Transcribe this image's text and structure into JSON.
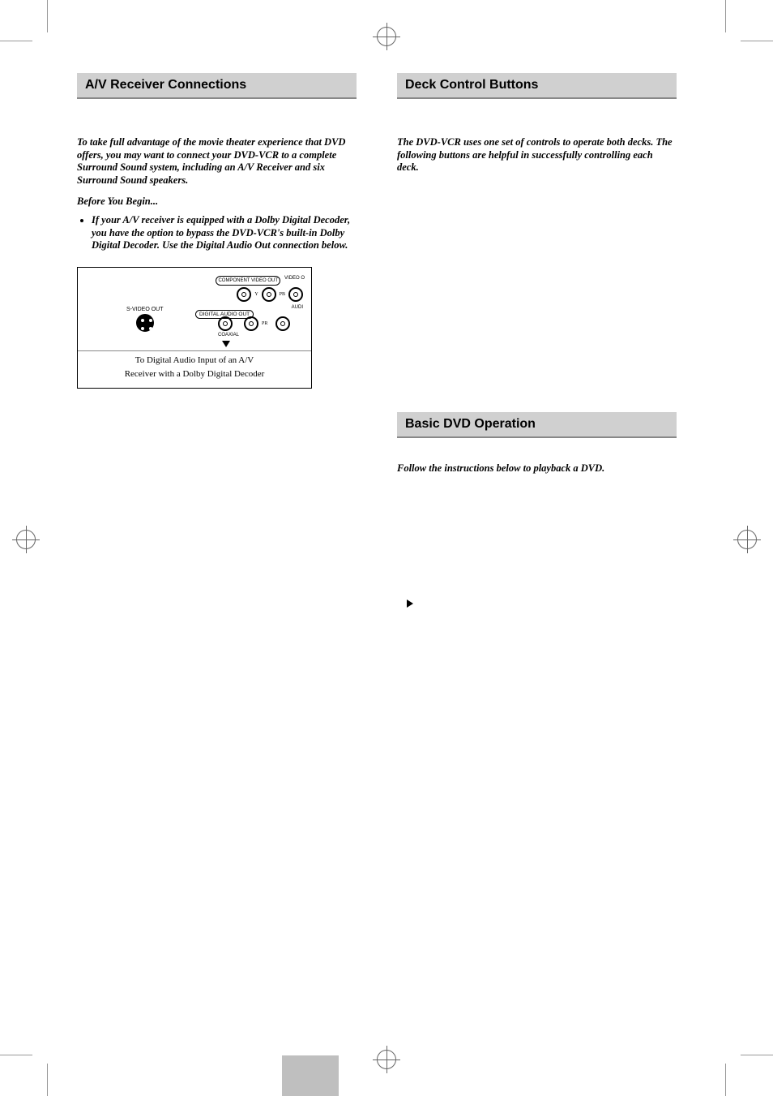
{
  "print_marks": {
    "present": true
  },
  "left": {
    "header": "A/V Receiver Connections",
    "intro": "To take full advantage of the movie theater experience that DVD offers, you may want to connect your DVD-VCR to a complete Surround Sound system, including an A/V Receiver and six Surround Sound speakers.",
    "before": "Before You Begin...",
    "bullet": "If your A/V receiver is equipped with a Dolby Digital Decoder, you have the option to bypass the DVD-VCR's built-in Dolby Digital Decoder. Use the Digital Audio Out connection below.",
    "diagram": {
      "panel_top": "COMPONENT VIDEO OUT",
      "panel_top_right": "VIDEO O",
      "digital_audio": "DIGITAL AUDIO OUT",
      "svideo": "S-VIDEO OUT",
      "coaxial": "COAXIAL",
      "audio_label": "AUDI",
      "y": "Y",
      "pb": "PB",
      "pr": "PR",
      "caption1": "To Digital Audio Input of an A/V",
      "caption2": "Receiver with a Dolby Digital Decoder"
    }
  },
  "right_upper": {
    "header": "Deck Control Buttons",
    "intro": "The DVD-VCR uses one set of controls to operate both decks. The following buttons are helpful in successfully controlling each deck."
  },
  "right_lower": {
    "header": "Basic DVD Operation",
    "intro": "Follow the instructions below to playback a DVD."
  }
}
